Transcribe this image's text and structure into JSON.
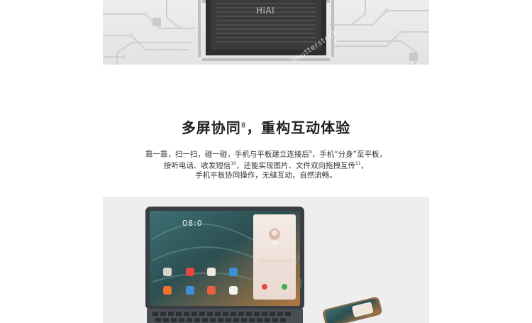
{
  "banner": {
    "chip_label": "HiAI",
    "watermark": "shutterstock"
  },
  "section": {
    "headline": {
      "text_before": "多屏协同",
      "superscript": "8",
      "text_after": "，重构互动体验"
    },
    "description": {
      "line1": {
        "text": "靠一靠，扫一扫，碰一碰，手机与平板建立连接后",
        "sup": "9",
        "after": "，手机“分身”至平板，"
      },
      "line2": {
        "text": "接听电话、收发短信",
        "sup": "10",
        "mid": "，还能实现图片、文件双向拖拽互传",
        "sup2": "11",
        "after": "，"
      },
      "line3": {
        "text": "手机平板协同操作，无缝互动，自然流畅。"
      }
    }
  },
  "product_image": {
    "tablet_clock": "08:0",
    "caller_name": "小美"
  },
  "colors": {
    "page_background": "#ffffff",
    "headline": "#222222",
    "body_text": "#333333",
    "banner_background": "#e8e8e8",
    "chip_dark": "#2b2b2b",
    "tablet_bezel": "#3a3e44"
  }
}
